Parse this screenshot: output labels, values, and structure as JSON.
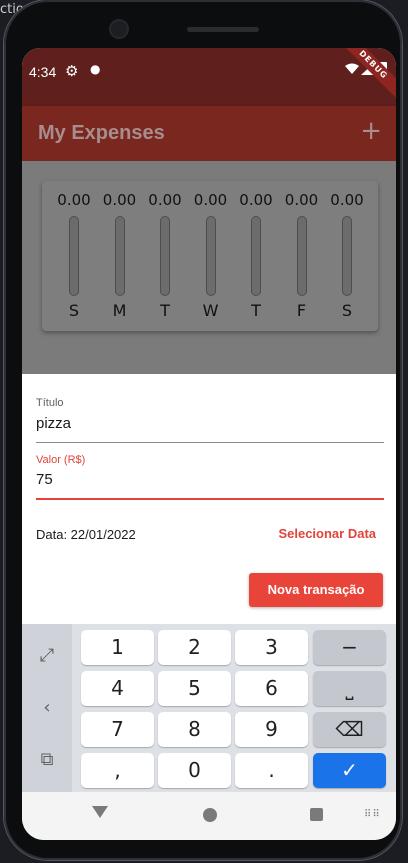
{
  "desktop": {
    "fragment": "ctio"
  },
  "status_bar": {
    "time": "4:34",
    "debug_banner": "DEBUG"
  },
  "app_bar": {
    "title": "My Expenses",
    "add_label": "+"
  },
  "chart_data": {
    "type": "bar",
    "categories": [
      "S",
      "M",
      "T",
      "W",
      "T",
      "F",
      "S"
    ],
    "values": [
      0,
      0,
      0,
      0,
      0,
      0,
      0
    ],
    "value_labels": [
      "0.00",
      "0.00",
      "0.00",
      "0.00",
      "0.00",
      "0.00",
      "0.00"
    ]
  },
  "form": {
    "title_label": "Título",
    "title_value": "pizza",
    "value_label": "Valor (R$)",
    "value_value": "75",
    "date_text": "Data: 22/01/2022",
    "select_date_label": "Selecionar Data",
    "submit_label": "Nova transação"
  },
  "keyboard": {
    "rows": [
      [
        "1",
        "2",
        "3",
        "−"
      ],
      [
        "4",
        "5",
        "6",
        "⎵"
      ],
      [
        "7",
        "8",
        "9",
        "⌫"
      ],
      [
        ",",
        "0",
        ".",
        "✓"
      ]
    ]
  },
  "colors": {
    "status_bar": "#5f1f1c",
    "app_bar": "#7a2720",
    "accent": "#e9443a",
    "keyboard_ok": "#1a73e8"
  }
}
